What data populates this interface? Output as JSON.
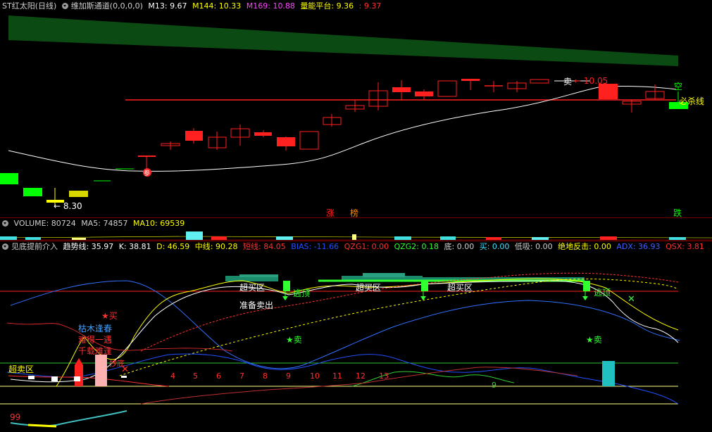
{
  "main_header": {
    "title": "ST红太阳(日线)",
    "indicator1_name": "维加斯通道(0,0,0,0)",
    "m13": "M13: 9.67",
    "m144": "M144: 10.33",
    "m169": "M169: 10.88",
    "platform_label": "量能平台: 9.36",
    "platform_value2": ": 9.37"
  },
  "main_chart": {
    "price_low_label": "← 8.30",
    "price_high_label": "← 10.05",
    "sell_tag": "卖",
    "must_kill_label": "必杀线",
    "ref_label": "参",
    "zhang_label": "涨",
    "bang_label": "榜",
    "die_label": "跌",
    "kong_label": "空"
  },
  "volume_header": {
    "volume": "VOLUME: 80724",
    "ma5": "MA5: 74857",
    "ma10": "MA10: 69539"
  },
  "indicator_header": {
    "name": "见底提前介入",
    "trend": "趋势线: 35.97",
    "k": "K: 38.81",
    "d": "D: 46.59",
    "mid": "中线: 90.28",
    "short": "短线: 84.05",
    "bias": "BIAS: -11.66",
    "qzg1": "QZG1: 0.00",
    "qzg2": "QZG2: 0.18",
    "bottom": "底: 0.00",
    "buy": "买: 0.00",
    "low_absorb": "低吸: 0.00",
    "rebound": "绝地反击: 0.00",
    "adx": "ADX: 36.93",
    "qsx": "QSX: 3.81"
  },
  "indicator_chart": {
    "oversold1": "超卖区",
    "oversold_bottom": "超卖区",
    "overbought1": "超买区",
    "overbought2": "超买区",
    "overbought3": "超买区",
    "escape1": "逃顶",
    "escape2": "逃顶",
    "prepare_sell": "准备卖出",
    "sell1": "★卖",
    "sell2": "★卖",
    "buy": "★买",
    "spring": "枯木逢春",
    "rare": "难得一遇",
    "meet": "千载难逢",
    "bottom_tag": "抄底",
    "num_99": "99",
    "counts": [
      "4",
      "5",
      "6",
      "7",
      "8",
      "9",
      "10",
      "11",
      "12",
      "13"
    ],
    "count_9b": "9"
  }
}
